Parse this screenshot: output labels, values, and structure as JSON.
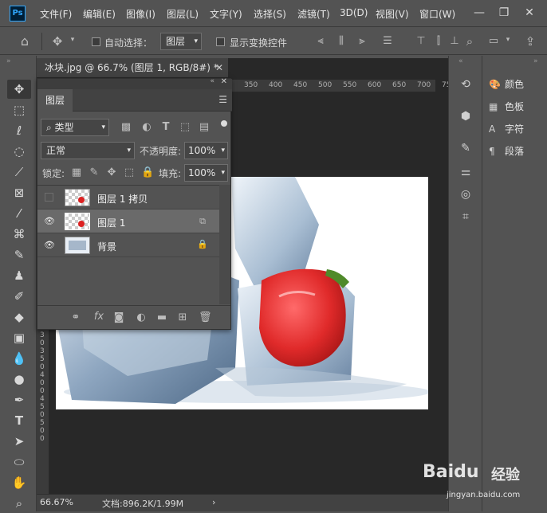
{
  "app": {
    "logo": "Ps"
  },
  "menu": [
    "文件(F)",
    "编辑(E)",
    "图像(I)",
    "图层(L)",
    "文字(Y)",
    "选择(S)",
    "滤镜(T)",
    "3D(D)",
    "视图(V)",
    "窗口(W)"
  ],
  "options": {
    "auto_select_label": "自动选择：",
    "auto_select_target": "图层",
    "show_transform_label": "显示变换控件"
  },
  "document": {
    "tab_title": "冰块.jpg @ 66.7% (图层 1, RGB/8#) *",
    "ruler_top": [
      "350",
      "400",
      "450",
      "500",
      "550",
      "600",
      "650",
      "700",
      "750"
    ],
    "ruler_left": [
      "3",
      "0",
      "3",
      "5",
      "0",
      "4",
      "0",
      "0",
      "4",
      "5",
      "0",
      "5",
      "0",
      "0"
    ]
  },
  "layers_panel": {
    "tab": "图层",
    "filter_kind": "类型",
    "blend_mode": "正常",
    "opacity_label": "不透明度:",
    "opacity_value": "100%",
    "lock_label": "锁定:",
    "fill_label": "填充:",
    "fill_value": "100%",
    "layers": [
      {
        "name": "图层 1 拷贝",
        "visible": false,
        "selected": false
      },
      {
        "name": "图层 1",
        "visible": true,
        "selected": true
      },
      {
        "name": "背景",
        "visible": true,
        "selected": false
      }
    ],
    "footer_fx": "fx"
  },
  "right_panel": {
    "items": [
      {
        "label": "颜色",
        "icon": "palette-icon"
      },
      {
        "label": "色板",
        "icon": "swatches-icon"
      },
      {
        "label": "字符",
        "icon": "character-icon"
      },
      {
        "label": "段落",
        "icon": "paragraph-icon"
      }
    ]
  },
  "status": {
    "zoom": "66.67%",
    "doc_info": "文档:896.2K/1.99M"
  },
  "watermark": {
    "text": "经验",
    "brand": "Baidu",
    "url": "jingyan.baidu.com"
  }
}
